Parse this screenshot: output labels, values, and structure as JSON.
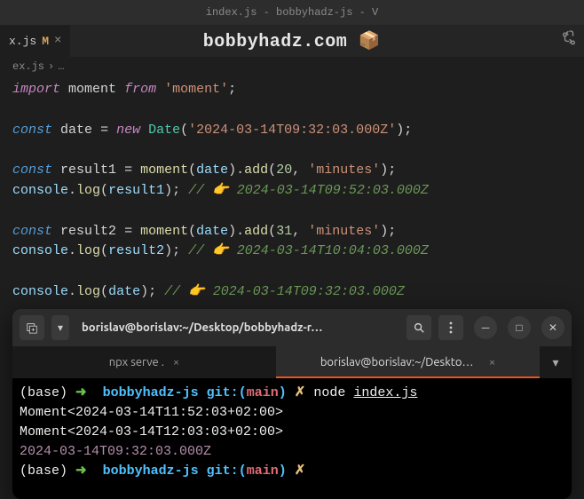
{
  "titlebar": {
    "text": "index.js - bobbyhadz-js - V"
  },
  "tab": {
    "name": "x.js",
    "modified": "M"
  },
  "watermark": {
    "text": "bobbyhadz.com 📦"
  },
  "breadcrumb": {
    "file": "ex.js",
    "sep": "›",
    "more": "…"
  },
  "code": {
    "l1": {
      "import": "import",
      "moment": "moment",
      "from": "from",
      "str": "'moment'"
    },
    "l2": {
      "const": "const",
      "date": "date",
      "eq": "=",
      "new": "new",
      "Date": "Date",
      "str": "'2024-03-14T09:32:03.000Z'"
    },
    "l3": {
      "const": "const",
      "result1": "result1",
      "eq": "=",
      "moment": "moment",
      "date": "date",
      "add": "add",
      "n": "20",
      "unit": "'minutes'"
    },
    "l4": {
      "console": "console",
      "log": "log",
      "result1": "result1",
      "cm": "// 👉 2024-03-14T09:52:03.000Z"
    },
    "l5": {
      "const": "const",
      "result2": "result2",
      "eq": "=",
      "moment": "moment",
      "date": "date",
      "add": "add",
      "n": "31",
      "unit": "'minutes'"
    },
    "l6": {
      "console": "console",
      "log": "log",
      "result2": "result2",
      "cm": "// 👉 2024-03-14T10:04:03.000Z"
    },
    "l7": {
      "console": "console",
      "log": "log",
      "date": "date",
      "cm": "// 👉 2024-03-14T09:32:03.000Z"
    }
  },
  "terminal": {
    "title": "borislav@borislav:~/Desktop/bobbyhadz-r…",
    "tabs": {
      "t1": "npx serve .",
      "t2": "borislav@borislav:~/Desktop/b…"
    },
    "prompt": {
      "base": "(base)",
      "arrow": "➜",
      "dir": "bobbyhadz-js",
      "git": "git:",
      "lp": "(",
      "branch": "main",
      "rp": ")",
      "x": "✗"
    },
    "cmd": {
      "node": "node",
      "file": "index.js"
    },
    "out1": "Moment<2024-03-14T11:52:03+02:00>",
    "out2": "Moment<2024-03-14T12:03:03+02:00>",
    "out3": "2024-03-14T09:32:03.000Z"
  }
}
